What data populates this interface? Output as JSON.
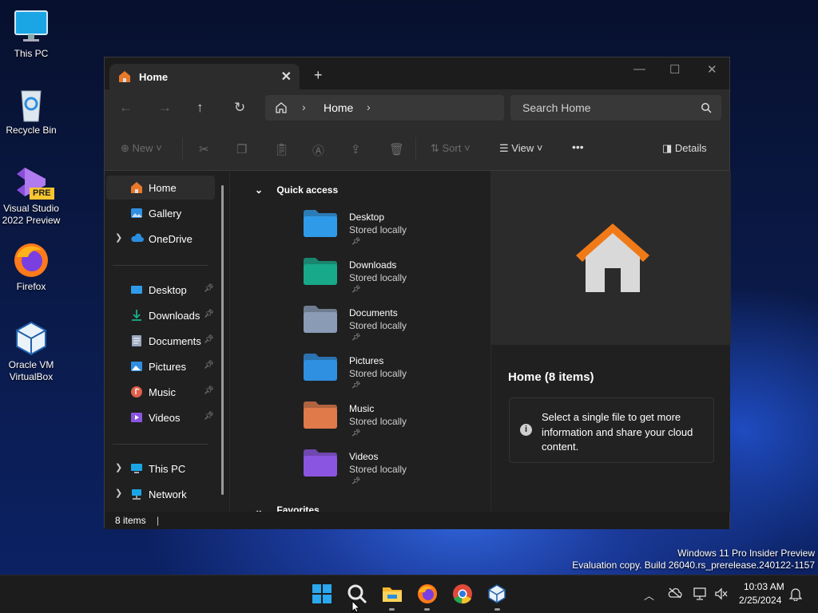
{
  "desktop": {
    "icons": [
      {
        "label": "This PC",
        "icon": "monitor-icon"
      },
      {
        "label": "Recycle Bin",
        "icon": "recycle-bin-icon"
      },
      {
        "label": "Visual Studio 2022 Preview",
        "badge": "PRE",
        "icon": "visual-studio-icon"
      },
      {
        "label": "Firefox",
        "icon": "firefox-icon"
      },
      {
        "label": "Oracle VM VirtualBox",
        "icon": "virtualbox-icon"
      }
    ],
    "watermark": {
      "line1": "Windows 11 Pro Insider Preview",
      "line2": "Evaluation copy. Build 26040.rs_prerelease.240122-1157"
    }
  },
  "explorer": {
    "tab": {
      "title": "Home",
      "close": "✕",
      "new_tab": "+"
    },
    "window_controls": {
      "minimize": "—",
      "maximize": "☐",
      "close": "✕"
    },
    "address": {
      "crumb": "Home",
      "sep": "›"
    },
    "search": {
      "placeholder": "Search Home",
      "icon": "search-icon"
    },
    "toolbar": {
      "new_label": "New",
      "sort_label": "Sort",
      "view_label": "View",
      "more_label": "•••",
      "details_label": "Details"
    },
    "sidebar": {
      "top": [
        {
          "label": "Home",
          "icon": "home-icon",
          "selected": true
        },
        {
          "label": "Gallery",
          "icon": "gallery-icon"
        },
        {
          "label": "OneDrive",
          "icon": "onedrive-icon",
          "expandable": true
        }
      ],
      "pinned": [
        {
          "label": "Desktop",
          "icon": "desktop-folder-icon"
        },
        {
          "label": "Downloads",
          "icon": "downloads-folder-icon"
        },
        {
          "label": "Documents",
          "icon": "documents-folder-icon"
        },
        {
          "label": "Pictures",
          "icon": "pictures-folder-icon"
        },
        {
          "label": "Music",
          "icon": "music-folder-icon"
        },
        {
          "label": "Videos",
          "icon": "videos-folder-icon"
        }
      ],
      "bottom": [
        {
          "label": "This PC",
          "icon": "this-pc-icon"
        },
        {
          "label": "Network",
          "icon": "network-icon"
        }
      ]
    },
    "content": {
      "section_title": "Quick access",
      "next_section": "Favorites",
      "items": [
        {
          "name": "Desktop",
          "status": "Stored locally",
          "color": "#2f9be8"
        },
        {
          "name": "Downloads",
          "status": "Stored locally",
          "color": "#18a88a"
        },
        {
          "name": "Documents",
          "status": "Stored locally",
          "color": "#8a9bb5"
        },
        {
          "name": "Pictures",
          "status": "Stored locally",
          "color": "#2f8fe0"
        },
        {
          "name": "Music",
          "status": "Stored locally",
          "color": "#e07a4a"
        },
        {
          "name": "Videos",
          "status": "Stored locally",
          "color": "#8a55e0"
        }
      ]
    },
    "details": {
      "title": "Home (8 items)",
      "info": "Select a single file to get more information and share your cloud content."
    },
    "status": {
      "count": "8 items"
    }
  },
  "taskbar": {
    "apps": [
      "start-icon",
      "search-icon",
      "file-explorer-icon",
      "firefox-icon",
      "chrome-icon",
      "virtualbox-icon"
    ],
    "tray": {
      "time": "10:03 AM",
      "date": "2/25/2024"
    }
  }
}
